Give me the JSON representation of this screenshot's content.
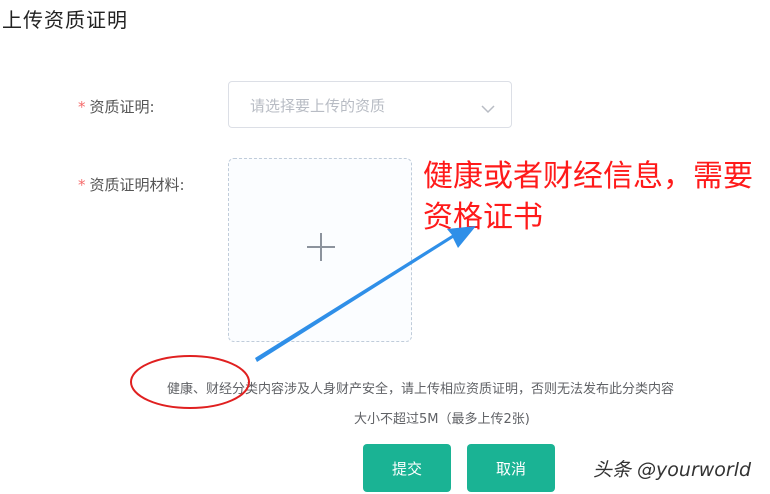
{
  "page": {
    "title": "上传资质证明"
  },
  "form": {
    "required_mark": "*",
    "qualification": {
      "label": "资质证明:",
      "placeholder": "请选择要上传的资质",
      "icon": "chevron-down-icon"
    },
    "material": {
      "label": "资质证明材料:",
      "upload_icon": "plus-icon"
    },
    "note_line1": "健康、财经分类内容涉及人身财产安全，请上传相应资质证明，否则无法发布此分类内容",
    "note_line2": "大小不超过5M（最多上传2张)",
    "submit_label": "提交",
    "cancel_label": "取消"
  },
  "annotation": {
    "text": "健康或者财经信息，需要资格证书",
    "color": "#ff1a1a",
    "arrow_color": "#2f8fe8",
    "circle_color": "#e02020"
  },
  "watermark": {
    "text": "头条 @yourworld"
  },
  "colors": {
    "primary_button": "#1ab394",
    "required": "#f56c6c"
  }
}
